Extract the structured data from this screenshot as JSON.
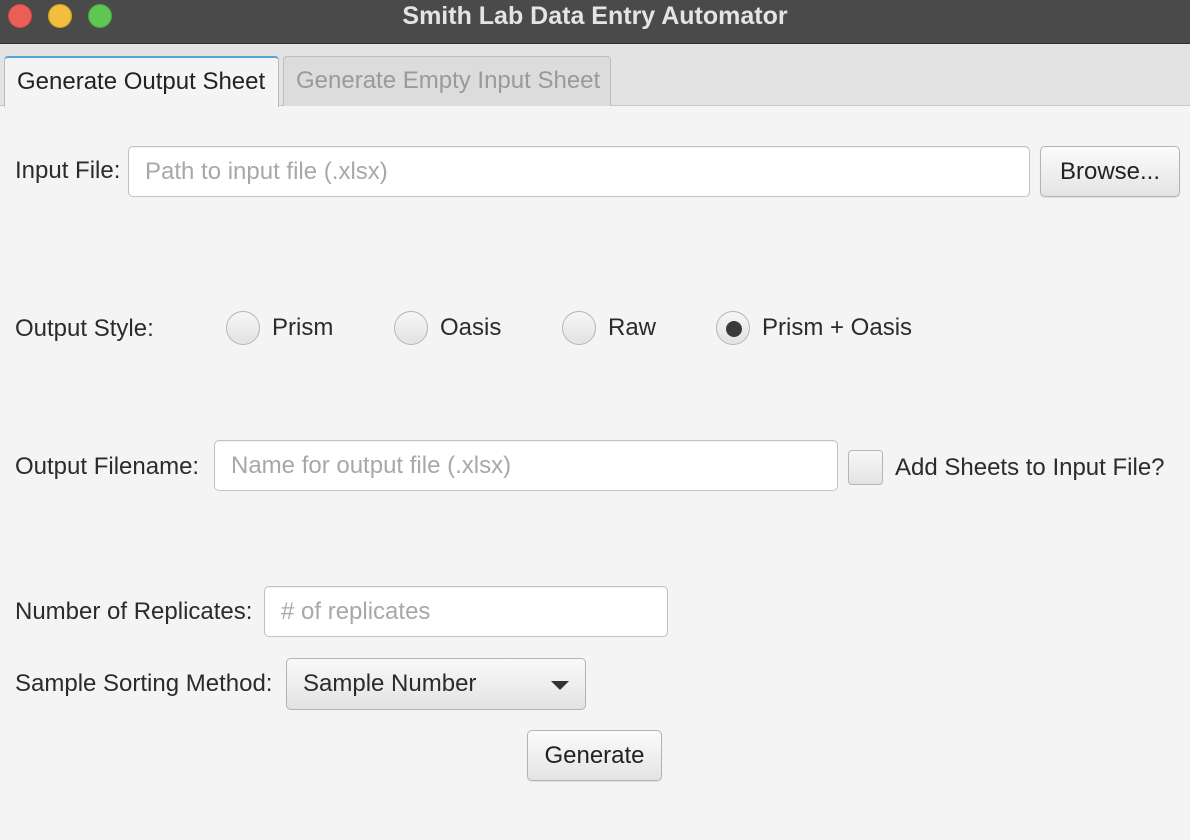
{
  "window": {
    "title": "Smith Lab Data Entry Automator"
  },
  "tabs": [
    {
      "label": "Generate Output Sheet",
      "active": true
    },
    {
      "label": "Generate Empty Input Sheet",
      "active": false
    }
  ],
  "input_file": {
    "label": "Input File:",
    "value": "",
    "placeholder": "Path to input file (.xlsx)",
    "browse_label": "Browse..."
  },
  "output_style": {
    "label": "Output Style:",
    "options": [
      "Prism",
      "Oasis",
      "Raw",
      "Prism + Oasis"
    ],
    "selected": "Prism + Oasis"
  },
  "output_filename": {
    "label": "Output Filename:",
    "value": "",
    "placeholder": "Name for output file (.xlsx)",
    "add_sheets_label": "Add Sheets to Input File?",
    "add_sheets_checked": false
  },
  "replicates": {
    "label": "Number of Replicates:",
    "value": "",
    "placeholder": "# of replicates"
  },
  "sorting": {
    "label": "Sample Sorting Method:",
    "selected": "Sample Number"
  },
  "generate_label": "Generate",
  "icons": {
    "select_arrow": "chevron-down-icon"
  }
}
